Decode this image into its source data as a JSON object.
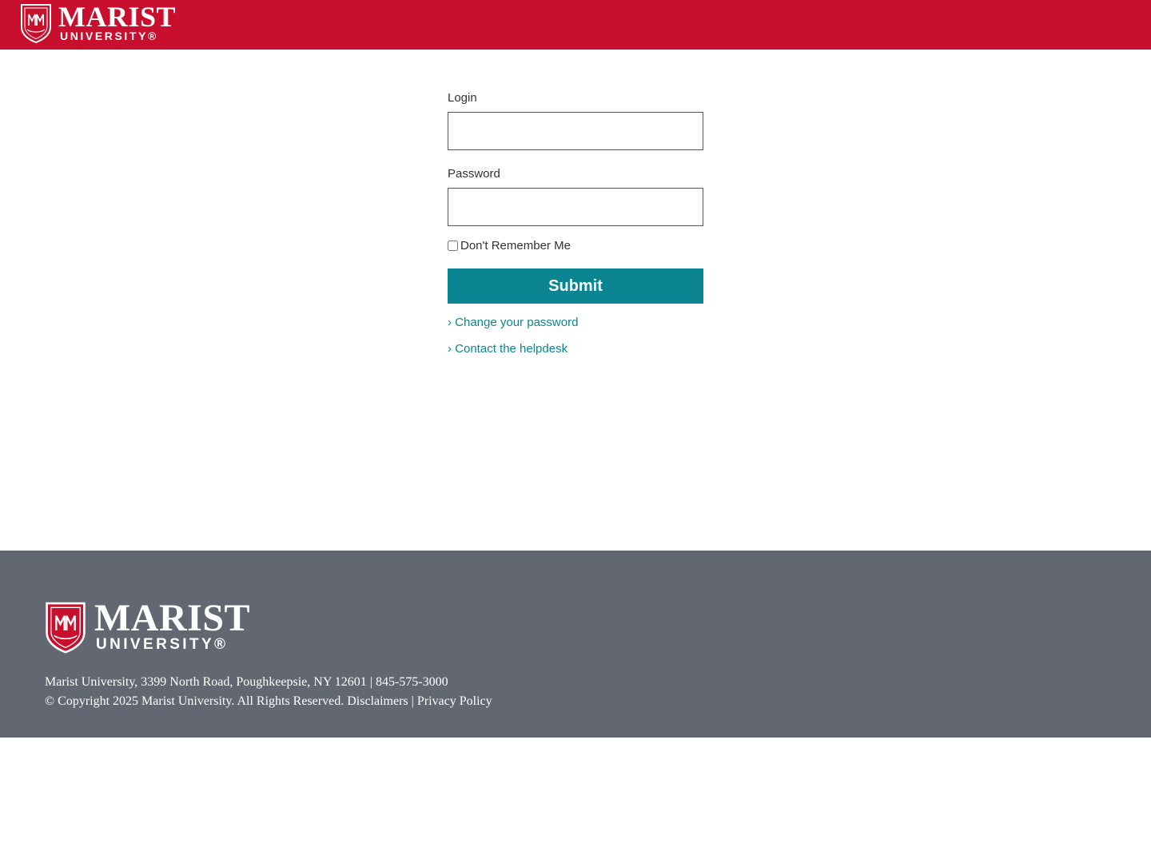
{
  "header": {
    "logo_name": "MARIST",
    "logo_sub": "UNIVERSITY®",
    "brand_color": "#c8102e"
  },
  "form": {
    "login_label": "Login",
    "login_value": "",
    "password_label": "Password",
    "password_value": "",
    "remember_label": "Don't Remember Me",
    "remember_checked": false,
    "submit_label": "Submit",
    "accent_color": "#0b8591"
  },
  "links": {
    "change_password": "› Change your password",
    "helpdesk": "› Contact the helpdesk"
  },
  "footer": {
    "logo_name": "MARIST",
    "logo_sub": "UNIVERSITY®",
    "address": "Marist University, 3399 North Road, Poughkeepsie, NY 12601 | 845-575-3000",
    "copyright": "© Copyright 2025 Marist University. All Rights Reserved.",
    "disclaimers": "Disclaimers",
    "separator": "|",
    "privacy": "Privacy Policy",
    "background_color": "#636771"
  },
  "icons": [
    "marist-crest-icon"
  ]
}
